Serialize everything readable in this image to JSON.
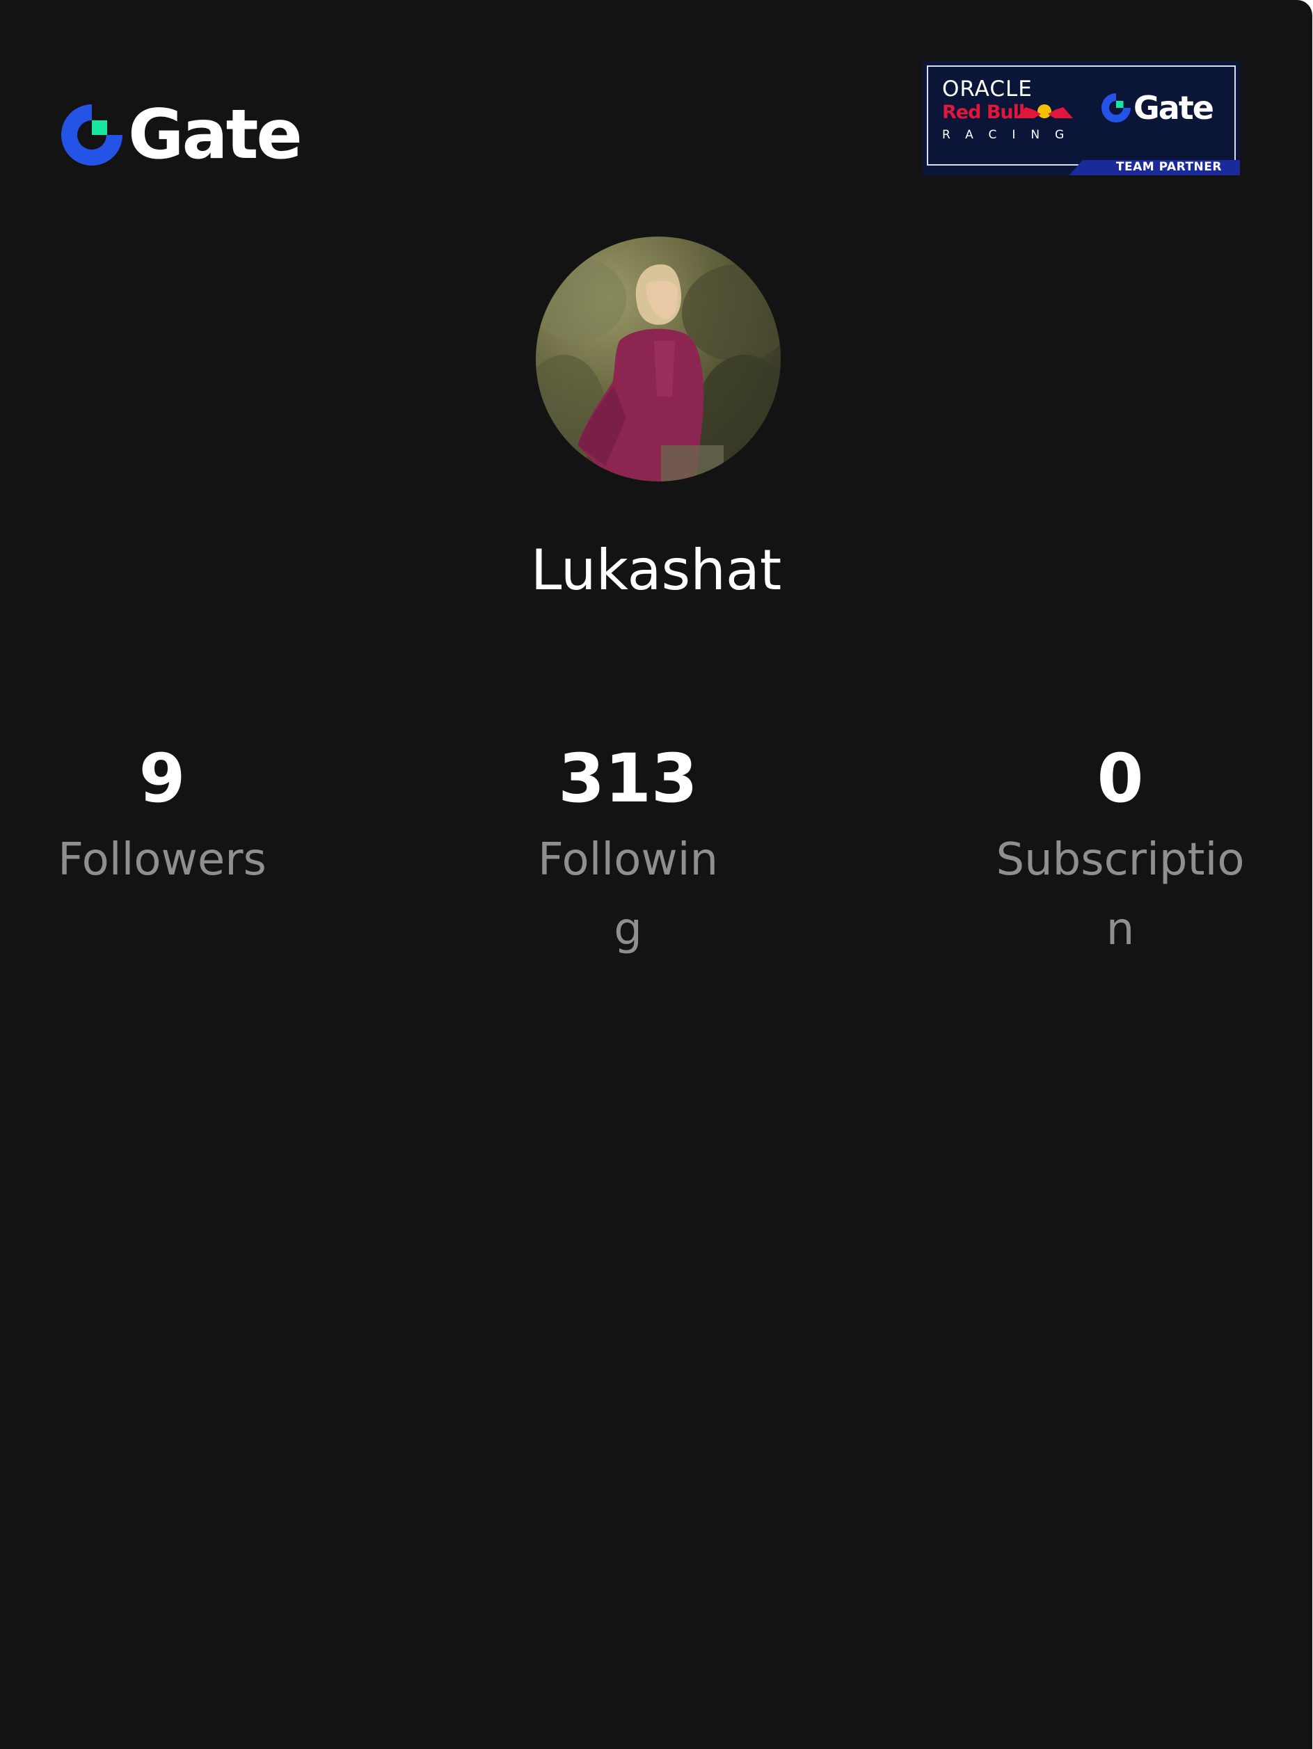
{
  "brand": {
    "logo_text": "Gate",
    "colors": {
      "blue": "#2354e6",
      "green": "#17e6a1",
      "background": "#131313"
    }
  },
  "partner_badge": {
    "line1": "ORACLE",
    "line2": "Red Bull",
    "line3": "RACING",
    "gate_text": "Gate",
    "footer": "TEAM PARTNER"
  },
  "profile": {
    "avatar": "profile-photo",
    "username": "Lukashat"
  },
  "stats": {
    "followers": {
      "value": "9",
      "label": "Followers"
    },
    "following": {
      "value": "313",
      "label": "Following"
    },
    "subscription": {
      "value": "0",
      "label": "Subscription"
    }
  }
}
